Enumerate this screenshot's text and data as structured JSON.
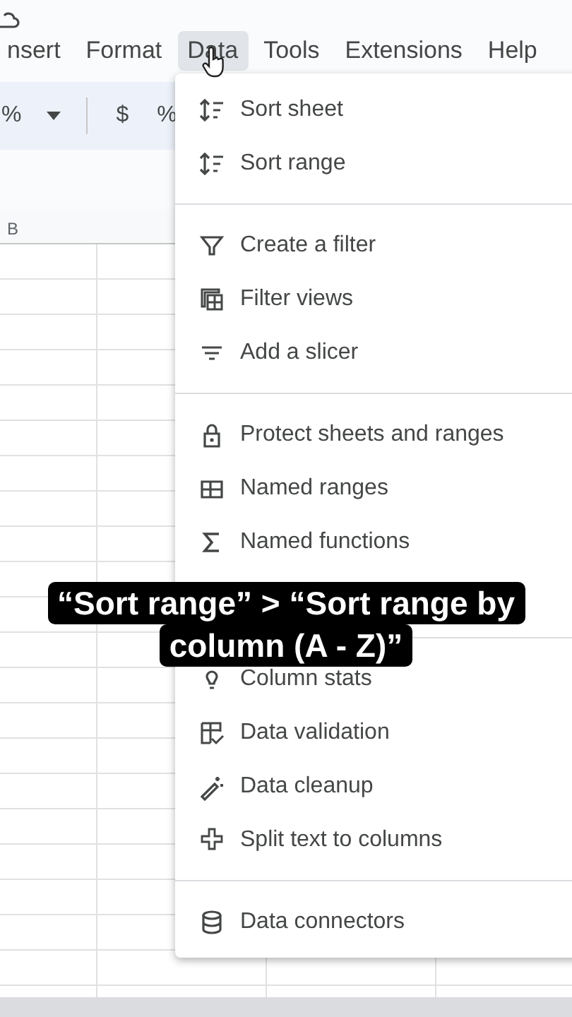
{
  "menu_bar": [
    {
      "label": "nsert",
      "selected": false
    },
    {
      "label": "Format",
      "selected": false
    },
    {
      "label": "Data",
      "selected": true
    },
    {
      "label": "Tools",
      "selected": false
    },
    {
      "label": "Extensions",
      "selected": false
    },
    {
      "label": "Help",
      "selected": false
    }
  ],
  "toolbar": [
    {
      "kind": "text",
      "label": "%"
    },
    {
      "kind": "caret"
    },
    {
      "kind": "divider"
    },
    {
      "kind": "text",
      "label": "$"
    },
    {
      "kind": "text",
      "label": "%"
    }
  ],
  "column_headers": [
    "B"
  ],
  "data_menu": [
    [
      {
        "label": "Sort sheet"
      },
      {
        "label": "Sort range"
      }
    ],
    [
      {
        "label": "Create a filter"
      },
      {
        "label": "Filter views"
      },
      {
        "label": "Add a slicer"
      }
    ],
    [
      {
        "label": "Protect sheets and ranges"
      },
      {
        "label": "Named ranges"
      },
      {
        "label": "Named functions"
      }
    ],
    [
      {
        "label": "Column stats"
      },
      {
        "label": "Data validation"
      },
      {
        "label": "Data cleanup"
      },
      {
        "label": "Split text to columns"
      }
    ],
    [
      {
        "label": "Data connectors"
      }
    ]
  ],
  "caption": [
    "“Sort range” > “Sort range by",
    "column (A - Z)”"
  ]
}
